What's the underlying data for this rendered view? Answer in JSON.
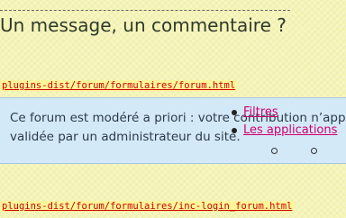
{
  "heading": {
    "title": "Un message, un commentaire ?"
  },
  "code_paths": {
    "forum_form": "plugins-dist/forum/formulaires/forum.html",
    "login_form": "plugins-dist/forum/formulaires/inc-login_forum.html"
  },
  "notice": {
    "line1": "Ce forum est modéré a priori : votre contribution n’apparaîtra qu’après avoir été",
    "line2": "validée par un administrateur du site."
  },
  "menu": {
    "items": [
      {
        "label": "Filtres"
      },
      {
        "label": "Les applications"
      }
    ]
  },
  "colors": {
    "background": "#f5f4b4",
    "notice_bg": "#d4e9f8",
    "path_text": "#cc0000",
    "menu_link": "#d0006f"
  }
}
